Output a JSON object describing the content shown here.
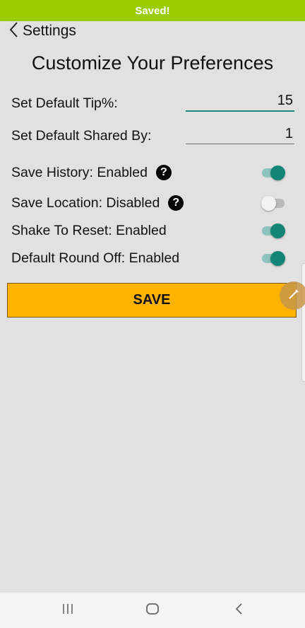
{
  "banner": {
    "text": "Saved!"
  },
  "header": {
    "back_icon": "chevron-left-icon",
    "title": "Settings"
  },
  "page": {
    "heading": "Customize Your Preferences"
  },
  "fields": {
    "tip": {
      "label": "Set Default Tip%:",
      "value": "15"
    },
    "shared_by": {
      "label": "Set Default Shared By:",
      "value": "1"
    }
  },
  "toggles": {
    "save_history": {
      "label": "Save History: Enabled",
      "enabled": true,
      "help": "?"
    },
    "save_location": {
      "label": "Save Location: Disabled",
      "enabled": false,
      "help": "?"
    },
    "shake_to_reset": {
      "label": "Shake To Reset: Enabled",
      "enabled": true
    },
    "round_off": {
      "label": "Default Round Off: Enabled",
      "enabled": true
    }
  },
  "actions": {
    "save_label": "SAVE"
  },
  "colors": {
    "banner": "#9acc00",
    "accent_teal": "#138577",
    "save_button": "#ffb300",
    "background": "#e1e1e1"
  },
  "navbar": {
    "recents_icon": "recent-apps-icon",
    "home_icon": "home-icon",
    "back_icon": "back-icon"
  }
}
